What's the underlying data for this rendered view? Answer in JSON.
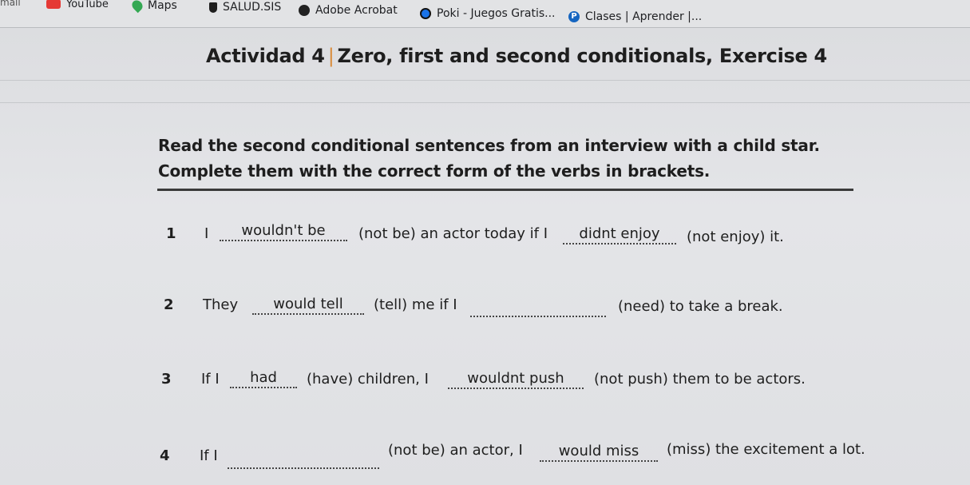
{
  "bookmarks": [
    {
      "label": "mail",
      "icon": "mail-icon"
    },
    {
      "label": "YouTube",
      "icon": "youtube-icon"
    },
    {
      "label": "Maps",
      "icon": "maps-pin-icon"
    },
    {
      "label": "SALUD.SIS",
      "icon": "shield-icon"
    },
    {
      "label": "Adobe Acrobat",
      "icon": "acrobat-icon"
    },
    {
      "label": "Poki - Juegos Gratis...",
      "icon": "poki-icon"
    },
    {
      "label": "Clases | Aprender |...",
      "icon": "p-circle-icon"
    }
  ],
  "worksheet": {
    "title_prefix": "Actividad 4",
    "title_separator": "|",
    "title_main": "Zero, first and second conditionals, Exercise 4",
    "instruction_line1": "Read the second conditional sentences from an interview with a child star.",
    "instruction_line2": "Complete them with the correct form of the verbs in brackets.",
    "items": [
      {
        "number": "1",
        "start": "I",
        "answer1": "wouldn't be",
        "middle": "(not be) an actor today if I",
        "answer2": "didnt enjoy",
        "end": "(not enjoy) it."
      },
      {
        "number": "2",
        "start": "They",
        "answer1": "would tell",
        "middle": "(tell) me if I",
        "answer2": "",
        "end": "(need) to take a break."
      },
      {
        "number": "3",
        "start": "If I",
        "answer1": "had",
        "middle": "(have) children, I",
        "answer2": "wouldnt push",
        "end": "(not push) them to be actors."
      },
      {
        "number": "4",
        "start": "If I",
        "answer1": "",
        "middle": "(not be) an actor, I",
        "answer2": "would miss",
        "end": "(miss) the excitement a lot."
      }
    ]
  }
}
